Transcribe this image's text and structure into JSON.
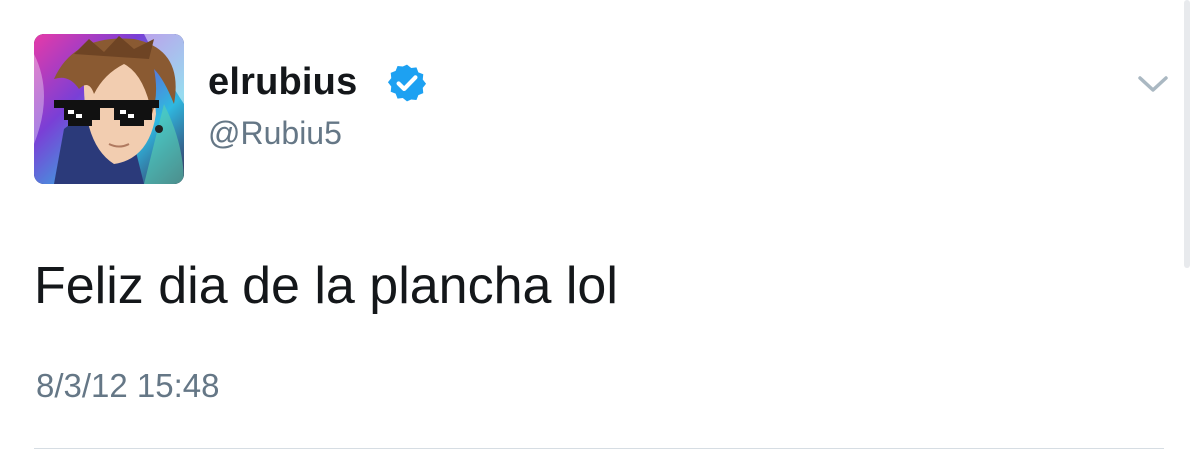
{
  "tweet": {
    "display_name": "elrubius",
    "handle": "@Rubiu5",
    "verified": true,
    "text": "Feliz dia de la plancha lol",
    "timestamp": "8/3/12 15:48"
  },
  "icons": {
    "verified": "verified-badge-icon",
    "menu": "chevron-down-icon"
  },
  "colors": {
    "verified_blue": "#1da1f2",
    "text_primary": "#14171a",
    "text_secondary": "#657786",
    "caret": "#aab8c2"
  }
}
